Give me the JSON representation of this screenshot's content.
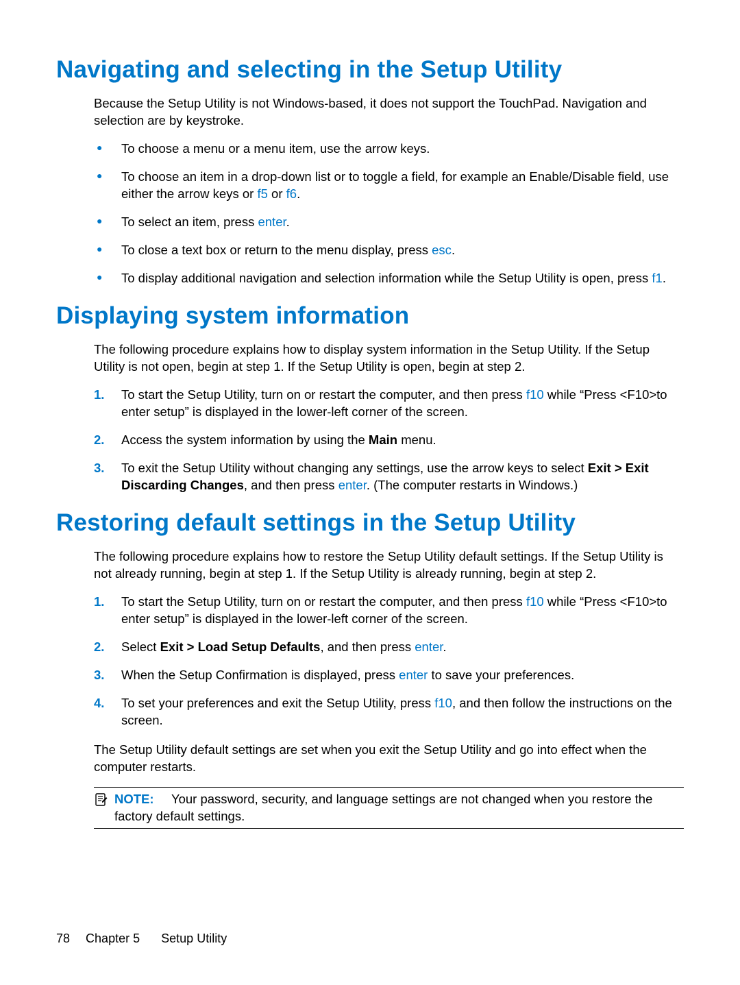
{
  "sections": {
    "nav": {
      "heading": "Navigating and selecting in the Setup Utility",
      "intro": "Because the Setup Utility is not Windows-based, it does not support the TouchPad. Navigation and selection are by keystroke.",
      "bullets": {
        "b1": "To choose a menu or a menu item, use the arrow keys.",
        "b2_a": "To choose an item in a drop-down list or to toggle a field, for example an Enable/Disable field, use either the arrow keys or ",
        "b2_f5": "f5",
        "b2_or": " or ",
        "b2_f6": "f6",
        "b2_end": ".",
        "b3_a": "To select an item, press ",
        "b3_enter": "enter",
        "b3_end": ".",
        "b4_a": "To close a text box or return to the menu display, press ",
        "b4_esc": "esc",
        "b4_end": ".",
        "b5_a": "To display additional navigation and selection information while the Setup Utility is open, press ",
        "b5_f1": "f1",
        "b5_end": "."
      }
    },
    "sysinfo": {
      "heading": "Displaying system information",
      "intro": "The following procedure explains how to display system information in the Setup Utility. If the Setup Utility is not open, begin at step 1. If the Setup Utility is open, begin at step 2.",
      "steps": {
        "s1_a": "To start the Setup Utility, turn on or restart the computer, and then press ",
        "s1_f10": "f10",
        "s1_b": " while “Press <F10>to enter setup” is displayed in the lower-left corner of the screen.",
        "s2_a": "Access the system information by using the ",
        "s2_main": "Main",
        "s2_b": " menu.",
        "s3_a": "To exit the Setup Utility without changing any settings, use the arrow keys to select ",
        "s3_exit": "Exit > Exit Discarding Changes",
        "s3_b": ", and then press ",
        "s3_enter": "enter",
        "s3_c": ". (The computer restarts in Windows.)"
      }
    },
    "restore": {
      "heading": "Restoring default settings in the Setup Utility",
      "intro": "The following procedure explains how to restore the Setup Utility default settings. If the Setup Utility is not already running, begin at step 1. If the Setup Utility is already running, begin at step 2.",
      "steps": {
        "s1_a": "To start the Setup Utility, turn on or restart the computer, and then press ",
        "s1_f10": "f10",
        "s1_b": " while “Press <F10>to enter setup” is displayed in the lower-left corner of the screen.",
        "s2_a": "Select ",
        "s2_bold": "Exit > Load Setup Defaults",
        "s2_b": ", and then press ",
        "s2_enter": "enter",
        "s2_c": ".",
        "s3_a": "When the Setup Confirmation is displayed, press ",
        "s3_enter": "enter",
        "s3_b": " to save your preferences.",
        "s4_a": "To set your preferences and exit the Setup Utility, press ",
        "s4_f10": "f10",
        "s4_b": ", and then follow the instructions on the screen."
      },
      "outro": "The Setup Utility default settings are set when you exit the Setup Utility and go into effect when the computer restarts.",
      "note_label": "NOTE:",
      "note_text": "Your password, security, and language settings are not changed when you restore the factory default settings."
    }
  },
  "footer": {
    "page": "78",
    "chapter_label": "Chapter 5",
    "chapter_title": "Setup Utility"
  }
}
